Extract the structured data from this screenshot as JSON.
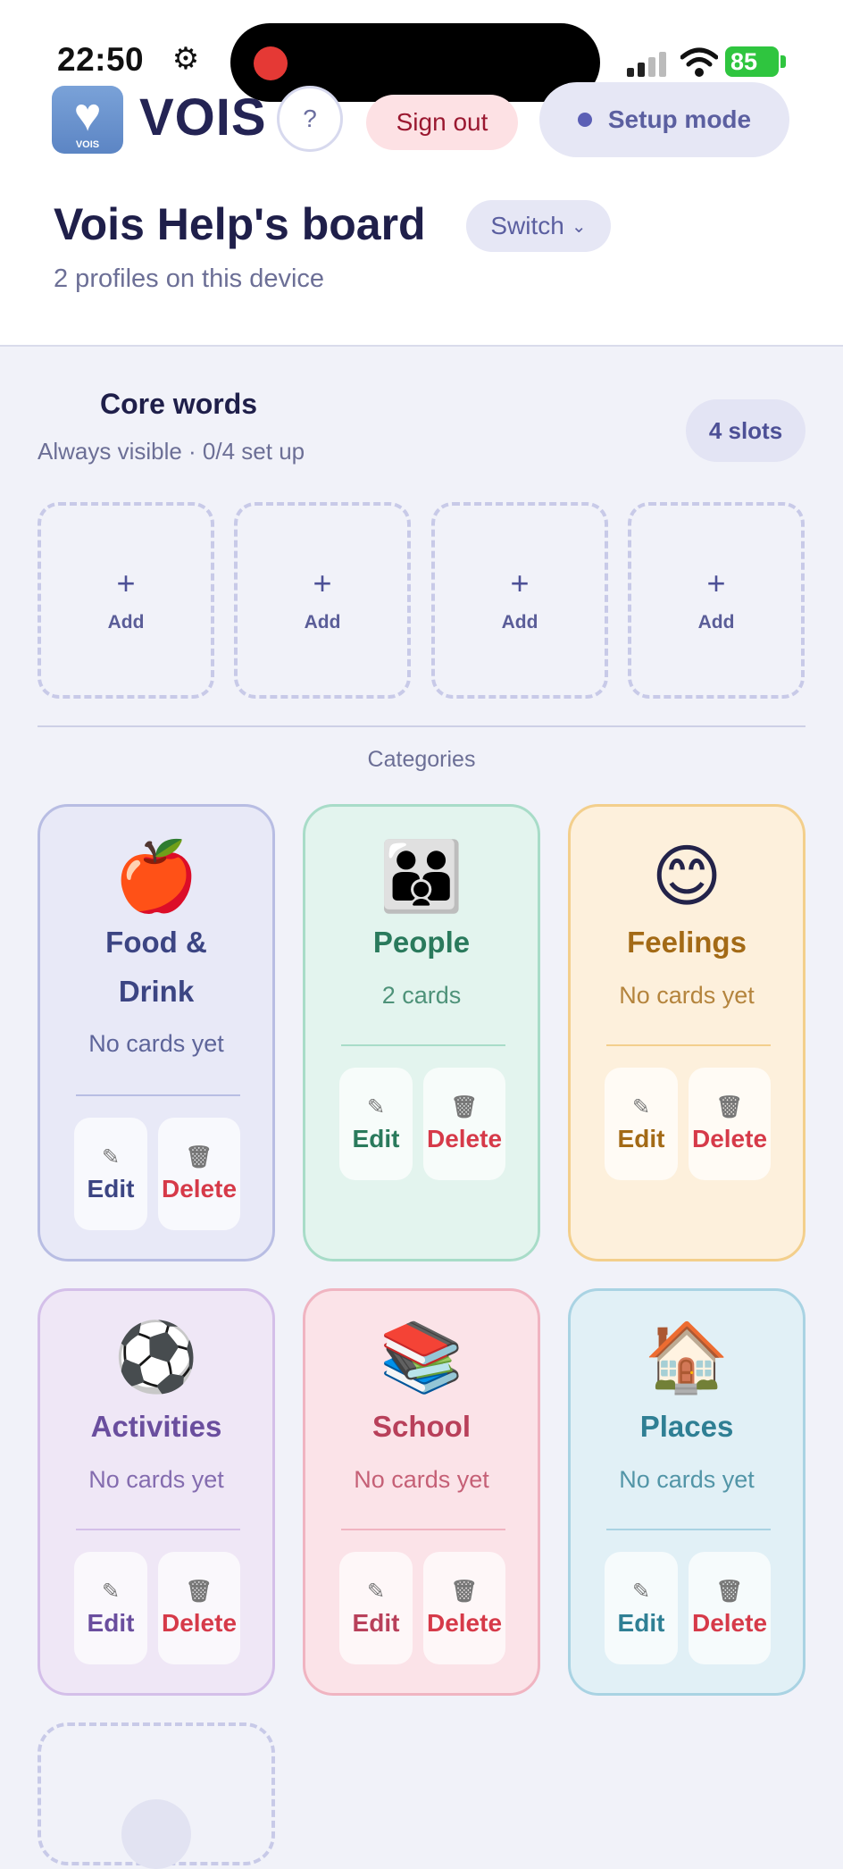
{
  "status_bar": {
    "time": "22:50",
    "battery": "85"
  },
  "header": {
    "logo_caption": "VOIS",
    "brand": "VOIS",
    "help_label": "?",
    "sign_out_label": "Sign out",
    "setup_mode_label": "Setup mode",
    "board_title": "Vois Help's board",
    "switch_label": "Switch",
    "profiles_text": "2 profiles on this device"
  },
  "core_words": {
    "title": "Core words",
    "subtitle": "Always visible · 0/4 set up",
    "slots_badge": "4 slots",
    "slots": [
      {
        "plus": "+",
        "label": "Add"
      },
      {
        "plus": "+",
        "label": "Add"
      },
      {
        "plus": "+",
        "label": "Add"
      },
      {
        "plus": "+",
        "label": "Add"
      }
    ]
  },
  "categories_label": "Categories",
  "categories": [
    {
      "emoji": "🍎",
      "title": "Food & Drink",
      "count": "No cards yet",
      "edit": "Edit",
      "delete": "Delete",
      "color": "#3c4583",
      "bg": "#e8e9f7",
      "border": "#b8bde3"
    },
    {
      "emoji": "👪",
      "title": "People",
      "count": "2 cards",
      "edit": "Edit",
      "delete": "Delete",
      "color": "#2a7a5c",
      "bg": "#e3f4ee",
      "border": "#a8dcc8"
    },
    {
      "emoji": "😊",
      "title": "Feelings",
      "count": "No cards yet",
      "edit": "Edit",
      "delete": "Delete",
      "color": "#a36a16",
      "bg": "#fdf0dc",
      "border": "#f3cf8c"
    },
    {
      "emoji": "⚽",
      "title": "Activities",
      "count": "No cards yet",
      "edit": "Edit",
      "delete": "Delete",
      "color": "#6a4e9e",
      "bg": "#efe7f6",
      "border": "#d4bfe9"
    },
    {
      "emoji": "📚",
      "title": "School",
      "count": "No cards yet",
      "edit": "Edit",
      "delete": "Delete",
      "color": "#b8405a",
      "bg": "#fbe3e8",
      "border": "#f0b4c1"
    },
    {
      "emoji": "🏠",
      "title": "Places",
      "count": "No cards yet",
      "edit": "Edit",
      "delete": "Delete",
      "color": "#2f7f94",
      "bg": "#e1f0f6",
      "border": "#a9d3e3"
    }
  ]
}
